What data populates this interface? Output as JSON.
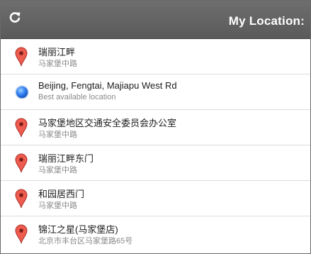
{
  "header": {
    "title": "My Location:",
    "refresh_icon": "refresh-icon"
  },
  "locations": [
    {
      "name": "瑞丽江畔",
      "detail": "马家堡中路",
      "icon": "map-pin-icon",
      "color": "#e8544a"
    },
    {
      "name": "Beijing, Fengtai, Majiapu West Rd",
      "detail": "Best available location",
      "icon": "current-location-dot-icon",
      "color": "#2d7ef0"
    },
    {
      "name": "马家堡地区交通安全委员会办公室",
      "detail": "马家堡中路",
      "icon": "map-pin-icon",
      "color": "#e8544a"
    },
    {
      "name": "瑞丽江畔东门",
      "detail": "马家堡中路",
      "icon": "map-pin-icon",
      "color": "#e8544a"
    },
    {
      "name": "和园居西门",
      "detail": "马家堡中路",
      "icon": "map-pin-icon",
      "color": "#e8544a"
    },
    {
      "name": "锦江之星(马家堡店)",
      "detail": "北京市丰台区马家堡路65号",
      "icon": "map-pin-icon",
      "color": "#e8544a"
    }
  ]
}
